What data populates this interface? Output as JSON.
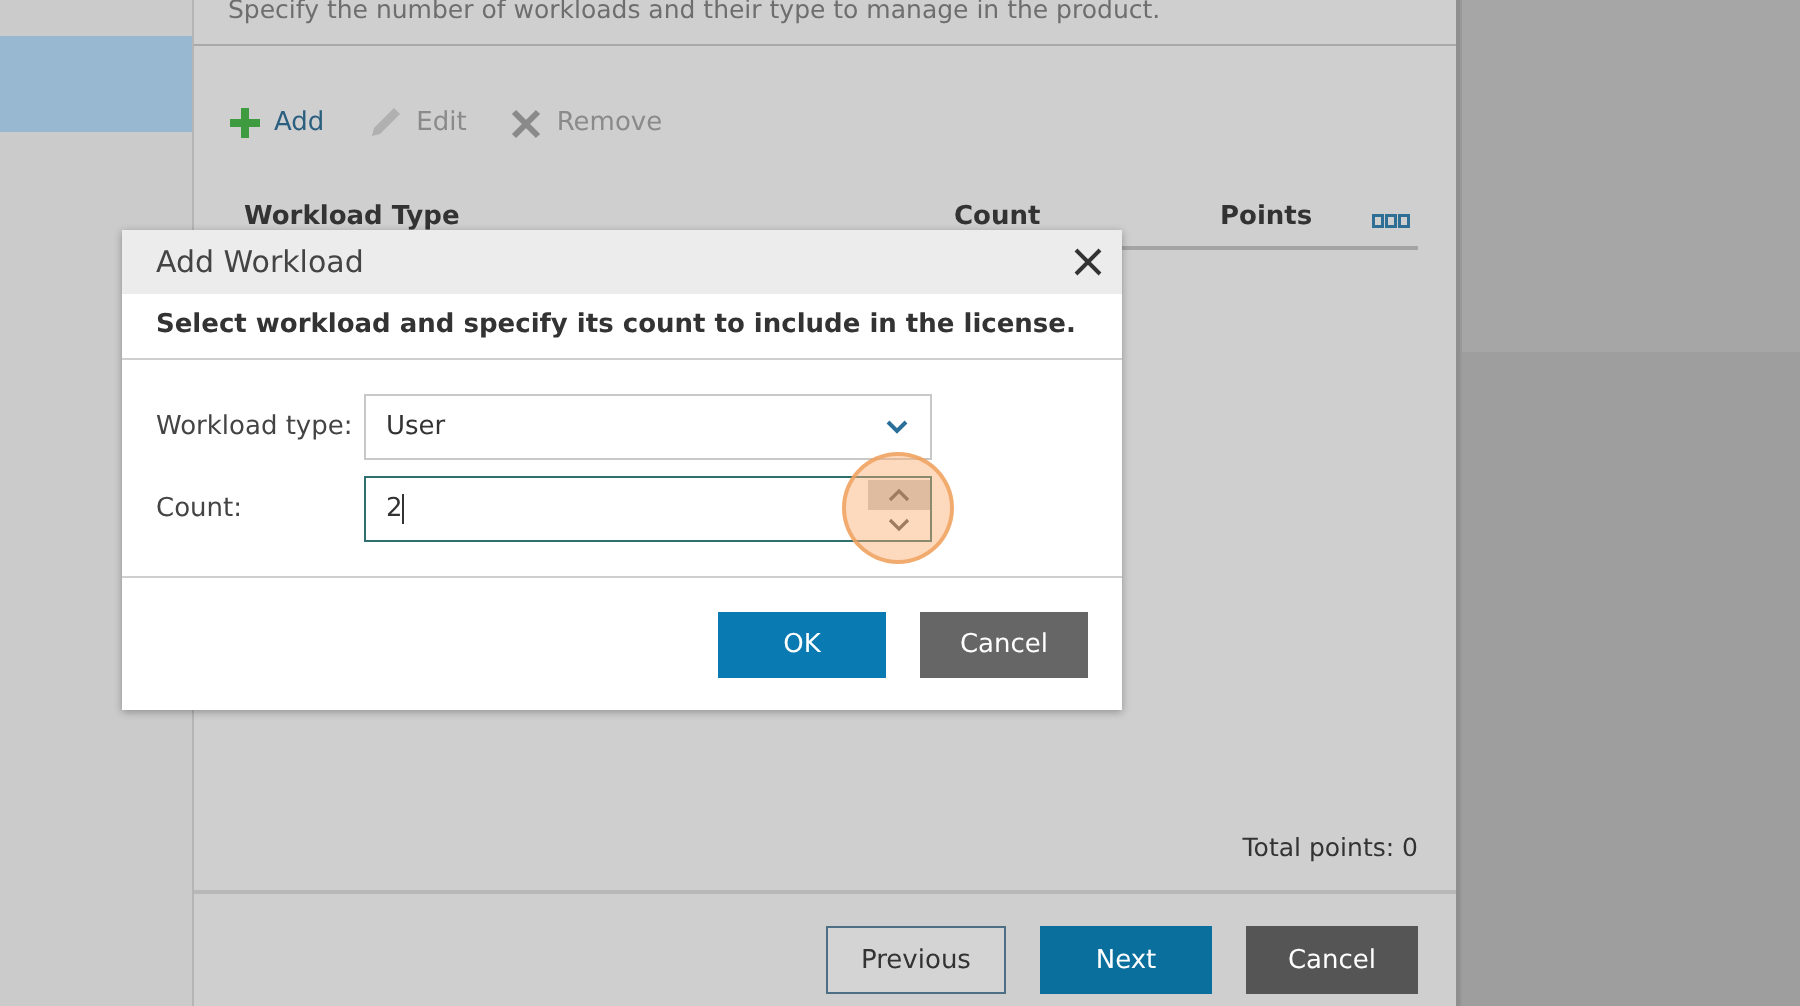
{
  "wizard": {
    "description": "Specify the number of workloads and their type to manage in the product.",
    "nav_items": [
      {
        "selected": true
      }
    ],
    "toolbar": [
      {
        "kind": "add",
        "label": "Add",
        "disabled": false
      },
      {
        "kind": "edit",
        "label": "Edit",
        "disabled": true
      },
      {
        "kind": "remove",
        "label": "Remove",
        "disabled": true
      }
    ],
    "table": {
      "columns": [
        "Workload Type",
        "Count",
        "Points"
      ]
    },
    "total": "Total points: 0",
    "buttons": [
      {
        "kind": "secondary",
        "label": "Previous"
      },
      {
        "kind": "primary",
        "label": "Next"
      },
      {
        "kind": "dark",
        "label": "Cancel"
      }
    ]
  },
  "dialog": {
    "title": "Add Workload",
    "subtitle": "Select workload and specify its count to include in the license.",
    "fields": [
      {
        "kind": "select",
        "label": "Workload type:",
        "value": "User",
        "focused": false
      },
      {
        "kind": "number",
        "label": "Count:",
        "value": "2",
        "focused": true
      }
    ],
    "buttons": [
      {
        "kind": "primary",
        "label": "OK"
      },
      {
        "kind": "dark",
        "label": "Cancel"
      }
    ]
  }
}
